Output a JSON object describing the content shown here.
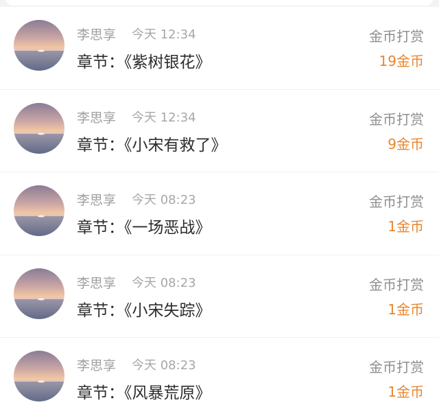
{
  "rewards": [
    {
      "user": "李思享",
      "time": "今天 12:34",
      "chapter_prefix": "章节：",
      "chapter": "《紫树银花》",
      "type": "金币打赏",
      "amount": "19金币"
    },
    {
      "user": "李思享",
      "time": "今天 12:34",
      "chapter_prefix": "章节：",
      "chapter": "《小宋有救了》",
      "type": "金币打赏",
      "amount": "9金币"
    },
    {
      "user": "李思享",
      "time": "今天 08:23",
      "chapter_prefix": "章节：",
      "chapter": "《一场恶战》",
      "type": "金币打赏",
      "amount": "1金币"
    },
    {
      "user": "李思享",
      "time": "今天 08:23",
      "chapter_prefix": "章节：",
      "chapter": "《小宋失踪》",
      "type": "金币打赏",
      "amount": "1金币"
    },
    {
      "user": "李思享",
      "time": "今天 08:23",
      "chapter_prefix": "章节：",
      "chapter": "《风暴荒原》",
      "type": "金币打赏",
      "amount": "1金币"
    }
  ],
  "colors": {
    "background": "#f3f3f3",
    "card": "#ffffff",
    "amount": "#e8862f",
    "muted_text": "#a0a0a0",
    "primary_text": "#2c2c2c"
  }
}
